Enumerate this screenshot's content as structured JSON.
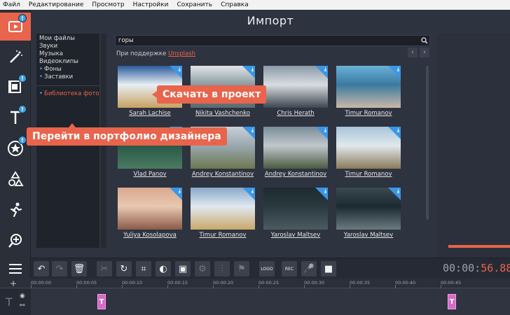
{
  "menu": [
    "Файл",
    "Редактирование",
    "Просмотр",
    "Настройки",
    "Сохранить",
    "Справка"
  ],
  "left_tools": [
    {
      "icon": "video-import-icon",
      "badge": "!",
      "active": true
    },
    {
      "icon": "magic-wand-icon",
      "badge": ""
    },
    {
      "icon": "film-filters-icon",
      "badge": "!"
    },
    {
      "icon": "text-icon",
      "badge": "!"
    },
    {
      "icon": "sticker-star-icon",
      "badge": "!"
    },
    {
      "icon": "shapes-icon",
      "badge": ""
    },
    {
      "icon": "running-man-icon",
      "badge": ""
    },
    {
      "icon": "zoom-icon",
      "badge": ""
    },
    {
      "icon": "menu-lines-icon",
      "badge": ""
    }
  ],
  "import": {
    "title": "Импорт",
    "categories": [
      "Мои файлы",
      "Звуки",
      "Музыка",
      "Видеоклипы",
      "Фоны",
      "Заставки"
    ],
    "library": "Библиотека фото",
    "search_value": "горы",
    "powered_by": "При поддержке",
    "powered_link": "Unsplash"
  },
  "photos": [
    {
      "author": "Sarah Lachise",
      "colors": [
        "#2a5a9a",
        "#c7a060",
        "#e8eef4"
      ]
    },
    {
      "author": "Nikita Vashchenko",
      "colors": [
        "#dfe5ea",
        "#5a6a70",
        "#8a9aa0"
      ]
    },
    {
      "author": "Chris Herath",
      "colors": [
        "#8a9aa8",
        "#3c4650",
        "#d8dde0"
      ]
    },
    {
      "author": "Timur Romanov",
      "colors": [
        "#6ab0d8",
        "#c9b8a8",
        "#3a7aa0"
      ]
    },
    {
      "author": "Vlad Panov",
      "colors": [
        "#1a3a30",
        "#4a7a60",
        "#2a5a48"
      ]
    },
    {
      "author": "Andrey Konstantinov",
      "colors": [
        "#c8d0d8",
        "#6a7850",
        "#9aa8b0"
      ]
    },
    {
      "author": "Andrey Konstantinov",
      "colors": [
        "#7a8c98",
        "#4a5a40",
        "#c0c8cc"
      ]
    },
    {
      "author": "Timur Romanov",
      "colors": [
        "#a8c4d8",
        "#8a7a5a",
        "#e0e8ee"
      ]
    },
    {
      "author": "Yuliya Kosolapova",
      "colors": [
        "#d8a890",
        "#8a5a48",
        "#e8c8b0"
      ]
    },
    {
      "author": "Timur Romanov",
      "colors": [
        "#8aa8c8",
        "#c8a86a",
        "#e0e8f0"
      ]
    },
    {
      "author": "Yaroslav Maltsev",
      "colors": [
        "#1e2a30",
        "#4a5a60",
        "#2a3a40"
      ]
    },
    {
      "author": "Yaroslav Maltsev",
      "colors": [
        "#3a4a50",
        "#6a7a80",
        "#1a2a30"
      ]
    }
  ],
  "callouts": {
    "download": "Скачать в проект",
    "portfolio": "Перейти в портфолио дизайнера"
  },
  "bottom_tools": [
    "undo-icon",
    "redo-icon",
    "trash-icon",
    "scissors-icon",
    "rotate-icon",
    "crop-icon",
    "color-icon",
    "fit-icon",
    "gear-icon",
    "equalizer-icon",
    "flag-icon",
    "logo-icon",
    "rec-icon",
    "mic-icon",
    "camera-icon"
  ],
  "timer": {
    "main": "00:00:",
    "frac": "56.88"
  },
  "ruler": [
    "00:00:00",
    "00:00:05",
    "00:00:10",
    "00:00:15",
    "00:00:20",
    "00:00:25",
    "00:00:30",
    "00:00:35",
    "00:00:40",
    "00:00:45"
  ],
  "clip_letter": "T",
  "colors": {
    "accent": "#e8644c",
    "badge": "#3aa0e8",
    "panel": "#2e3340"
  }
}
